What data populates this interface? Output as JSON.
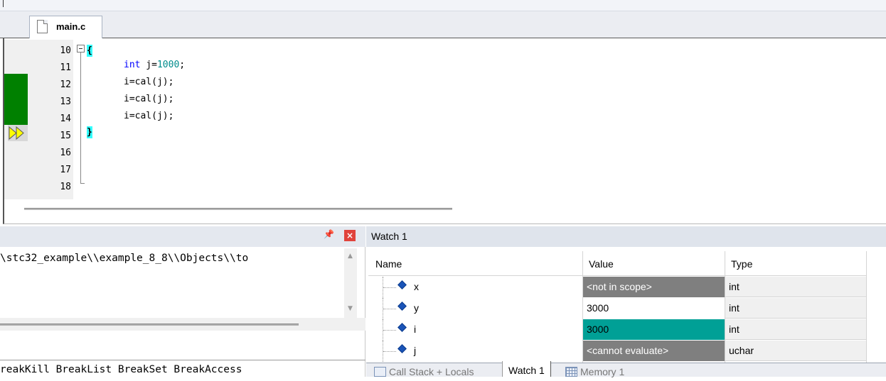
{
  "editor": {
    "tab_label": "main.c",
    "line_numbers": [
      "10",
      "11",
      "12",
      "13",
      "14",
      "15",
      "16",
      "17",
      "18"
    ],
    "open_brace": "{",
    "close_brace": "}",
    "code_lines": [
      {
        "kw": "int",
        "rest": " j=",
        "num": "1000",
        "tail": ";"
      },
      {
        "text": "i=cal(j);"
      },
      {
        "text": "i=cal(j);"
      },
      {
        "text": "i=cal(j);"
      }
    ],
    "breakpoint_color": "#008000",
    "brace_highlight_color": "#33ffff"
  },
  "left_panel": {
    "pin_icon": "pin-icon",
    "close_icon": "close-icon",
    "path_text": "\\stc32_example\\\\example_8_8\\\\Objects\\\\to",
    "command_text": "reakKill BreakList BreakSet BreakAccess"
  },
  "watch": {
    "title": "Watch 1",
    "columns": [
      "Name",
      "Value",
      "Type"
    ],
    "rows": [
      {
        "name": "x",
        "value": "<not in scope>",
        "type": "int",
        "value_bg": "#7f7f7f"
      },
      {
        "name": "y",
        "value": "3000",
        "type": "int",
        "value_bg": "#ffffff"
      },
      {
        "name": "i",
        "value": "3000",
        "type": "int",
        "value_bg": "#00a096"
      },
      {
        "name": "j",
        "value": "<cannot evaluate>",
        "type": "uchar",
        "value_bg": "#7f7f7f"
      }
    ]
  },
  "bottom_tabs": {
    "call_stack": "Call Stack + Locals",
    "watch": "Watch 1",
    "memory": "Memory 1"
  }
}
